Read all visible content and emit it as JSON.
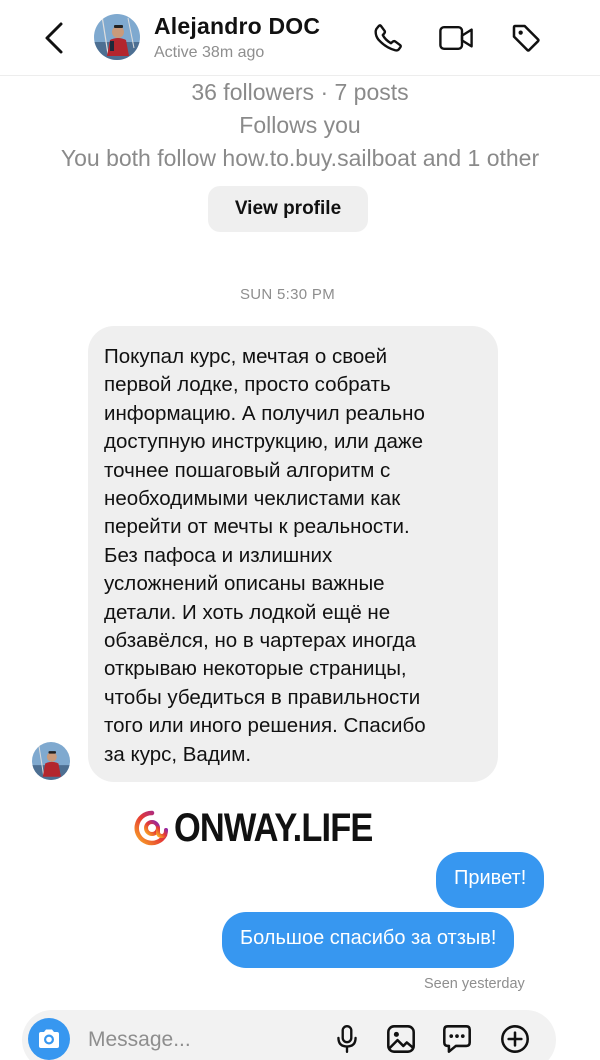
{
  "header": {
    "name": "Alejandro DOC",
    "status": "Active 38m ago"
  },
  "profile": {
    "stats": "36 followers · 7 posts",
    "follows_you": "Follows you",
    "mutual": "You both follow how.to.buy.sailboat and 1 other",
    "view_profile_label": "View profile"
  },
  "conversation": {
    "timestamp": "SUN 5:30 PM",
    "incoming_message": "Покупал курс, мечтая о своей\nпервой лодке, просто собрать\nинформацию. А получил реально\nдоступную инструкцию, или даже\nточнее пошаговый алгоритм с\nнеобходимыми чеклистами как\nперейти от мечты к реальности.\nБез пафоса и излишних\nусложнений описаны важные\nдетали. И хоть лодкой ещё не\nобзавёлся, но в чартерах иногда\nоткрываю некоторые страницы,\nчтобы убедиться в правильности\nтого или иного решения. Спасибо\nза курс, Вадим.",
    "outgoing_messages": [
      "Привет!",
      "Большое спасибо за отзыв!"
    ],
    "seen_status": "Seen yesterday"
  },
  "watermark": {
    "text": "ONWAY.LIFE"
  },
  "composer": {
    "placeholder": "Message..."
  },
  "colors": {
    "accent_blue": "#3797f0",
    "incoming_bubble": "#efefef",
    "secondary_text": "#8e8e8e"
  },
  "icons": {
    "back": "chevron-left-icon",
    "call": "phone-icon",
    "video": "video-camera-icon",
    "tag": "tag-icon",
    "camera": "camera-icon",
    "mic": "microphone-icon",
    "gallery": "image-icon",
    "sticker": "sticker-icon",
    "plus": "plus-circle-icon",
    "instagram": "instagram-logo-icon"
  }
}
